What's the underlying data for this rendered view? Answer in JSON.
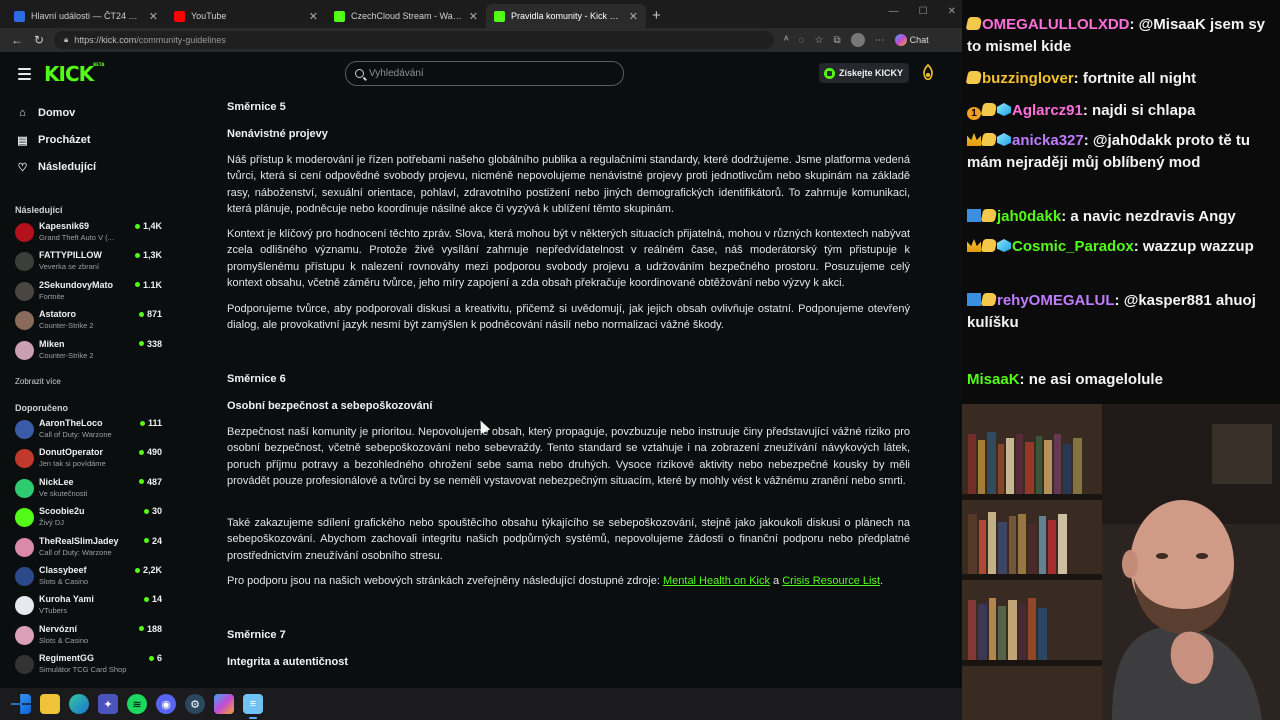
{
  "browser": {
    "tabs": [
      {
        "label": "Hlavní události — ČT24 — Česká t...",
        "color": "#2d6cdf"
      },
      {
        "label": "YouTube",
        "color": "#ff0000"
      },
      {
        "label": "CzechCloud Stream - Watch Live o...",
        "color": "#53fc18"
      },
      {
        "label": "Pravidla komunity - Kick Streaming",
        "color": "#53fc18"
      }
    ],
    "url_host": "https://kick.com",
    "url_path": "/community-guidelines",
    "chat_label": "Chat"
  },
  "site": {
    "search_placeholder": "Vyhledávání",
    "get_kicky": "Získejte KICKY",
    "nav": {
      "home": "Domov",
      "browse": "Procházet",
      "following": "Následující"
    },
    "following_heading": "Následující",
    "show_more": "Zobrazit více",
    "recommended_heading": "Doporučeno",
    "following_channels": [
      {
        "name": "Kapesnik69",
        "game": "Grand Theft Auto V (...",
        "count": "1,4K",
        "color": "#b3121c"
      },
      {
        "name": "FATTYPILLOW",
        "game": "Veverka se zbraní",
        "count": "1,3K",
        "color": "#3a3f3a"
      },
      {
        "name": "2SekundovyMato",
        "game": "Fortnite",
        "count": "1.1K",
        "color": "#4a4540"
      },
      {
        "name": "Astatoro",
        "game": "Counter-Strike 2",
        "count": "871",
        "color": "#8a6a5a"
      },
      {
        "name": "Miken",
        "game": "Counter-Strike 2",
        "count": "338",
        "color": "#c9a0b0"
      }
    ],
    "recommended_channels": [
      {
        "name": "AaronTheLoco",
        "game": "Call of Duty: Warzone",
        "count": "111",
        "color": "#3b5ba8"
      },
      {
        "name": "DonutOperator",
        "game": "Jen tak si povídáme",
        "count": "490",
        "color": "#c0392b"
      },
      {
        "name": "NickLee",
        "game": "Ve skutečnosti",
        "count": "487",
        "color": "#2ecc71"
      },
      {
        "name": "Scoobie2u",
        "game": "Živý DJ",
        "count": "30",
        "color": "#53fc18"
      },
      {
        "name": "TheRealSlimJadey",
        "game": "Call of Duty: Warzone",
        "count": "24",
        "color": "#d98aa8"
      },
      {
        "name": "Classybeef",
        "game": "Slots & Casino",
        "count": "2,2K",
        "color": "#2c4a8a"
      },
      {
        "name": "Kuroha Yami",
        "game": "VTubers",
        "count": "14",
        "color": "#e8e8f0"
      },
      {
        "name": "Nervózní",
        "game": "Slots & Casino",
        "count": "188",
        "color": "#d9a0b8"
      },
      {
        "name": "RegimentGG",
        "game": "Simulátor TCG Card Shop",
        "count": "6",
        "color": "#333"
      }
    ],
    "guidelines": {
      "s5_title": "Směrnice 5",
      "s5_subtitle": "Nenávistné projevy",
      "s5_p1": "Náš přístup k moderování je řízen potřebami našeho globálního publika a regulačními standardy, které dodržujeme. Jsme platforma vedená tvůrci, která si cení odpovědné svobody projevu, nicméně nepovolujeme nenávistné projevy proti jednotlivcům nebo skupinám na základě rasy, náboženství, sexuální orientace, pohlaví, zdravotního postižení nebo jiných demografických identifikátorů. To zahrnuje komunikaci, která plánuje, podněcuje nebo koordinuje násilné akce či vyzývá k ublížení těmto skupinám.",
      "s5_p2": "Kontext je klíčový pro hodnocení těchto zpráv. Slova, která mohou být v některých situacích přijatelná, mohou v různých kontextech nabývat zcela odlišného významu. Protože živé vysílání zahrnuje nepředvídatelnost v reálném čase, náš moderátorský tým přistupuje k promyšlenému přístupu k nalezení rovnováhy mezi podporou svobody projevu a udržováním bezpečného prostoru. Posuzujeme celý kontext obsahu, včetně záměru tvůrce, jeho míry zapojení a zda obsah překračuje koordinované obtěžování nebo výzvy k akci.",
      "s5_p3": "Podporujeme tvůrce, aby podporovali diskusi a kreativitu, přičemž si uvědomují, jak jejich obsah ovlivňuje ostatní. Podporujeme otevřený dialog, ale provokativní jazyk nesmí být zamýšlen k podněcování násilí nebo normalizaci vážné škody.",
      "s6_title": "Směrnice 6",
      "s6_subtitle": "Osobní bezpečnost a sebepoškozování",
      "s6_p1": "Bezpečnost naší komunity je prioritou. Nepovolujeme obsah, který propaguje, povzbuzuje nebo instruuje činy představující vážné riziko pro osobní bezpečnost, včetně sebepoškozování nebo sebevraždy. Tento standard se vztahuje i na zobrazení zneužívání návykových látek, poruch příjmu potravy a bezohledného ohrožení sebe sama nebo druhých. Vysoce rizikové aktivity nebo nebezpečné kousky by měli provádět pouze profesionálové a tvůrci by se neměli vystavovat nebezpečným situacím, které by mohly vést k vážnému zranění nebo smrti.",
      "s6_p2": "Také zakazujeme sdílení grafického nebo spouštěcího obsahu týkajícího se sebepoškozování, stejně jako jakoukoli diskusi o plánech na sebepoškozování. Abychom zachovali integritu našich podpůrných systémů, nepovolujeme žádosti o finanční podporu nebo předplatné prostřednictvím zneužívání osobního stresu.",
      "s6_p3_before": "Pro podporu jsou na našich webových stránkách zveřejněny následující dostupné zdroje: ",
      "s6_link1": "Mental Health on Kick",
      "s6_and": " a ",
      "s6_link2": "Crisis Resource List",
      "s6_p3_after": ".",
      "s7_title": "Směrnice 7",
      "s7_subtitle": "Integrita a autentičnost"
    }
  },
  "chat": {
    "messages": [
      {
        "user": "OMEGALULLOLXDD",
        "color": "#ff6fd8",
        "badges": [
          "hand"
        ],
        "text": "@MisaaK jsem sy to mismel kide"
      },
      {
        "user": "buzzinglover",
        "color": "#f2c12e",
        "badges": [
          "hand"
        ],
        "text": "fortnite all night"
      },
      {
        "user": "Aglarcz91",
        "color": "#ff6fd8",
        "badges": [
          "one",
          "hand",
          "gem"
        ],
        "text": "najdi si chlapa"
      },
      {
        "user": "anicka327",
        "color": "#c07cff",
        "badges": [
          "crown",
          "hand",
          "gem"
        ],
        "text": "@jah0dakk proto tě tu mám nejraději můj oblíbený mod"
      },
      {
        "user": "jah0dakk",
        "color": "#53fc18",
        "badges": [
          "bolt",
          "hand"
        ],
        "text": "a navic nezdravis Angy"
      },
      {
        "user": "Cosmic_Paradox",
        "color": "#53fc18",
        "badges": [
          "crown",
          "hand",
          "gem"
        ],
        "text": "wazzup wazzup"
      },
      {
        "user": "rehyOMEGALUL",
        "color": "#c07cff",
        "badges": [
          "bolt",
          "hand"
        ],
        "text": "@kasper881 ahuoj kulíšku"
      },
      {
        "user": "MisaaK",
        "color": "#53fc18",
        "badges": [],
        "text": "ne asi omagelolule"
      }
    ]
  },
  "taskbar": {
    "apps": [
      "start",
      "file-explorer",
      "edge",
      "teams",
      "spotify",
      "discord",
      "steam",
      "copilot",
      "notepad"
    ]
  }
}
